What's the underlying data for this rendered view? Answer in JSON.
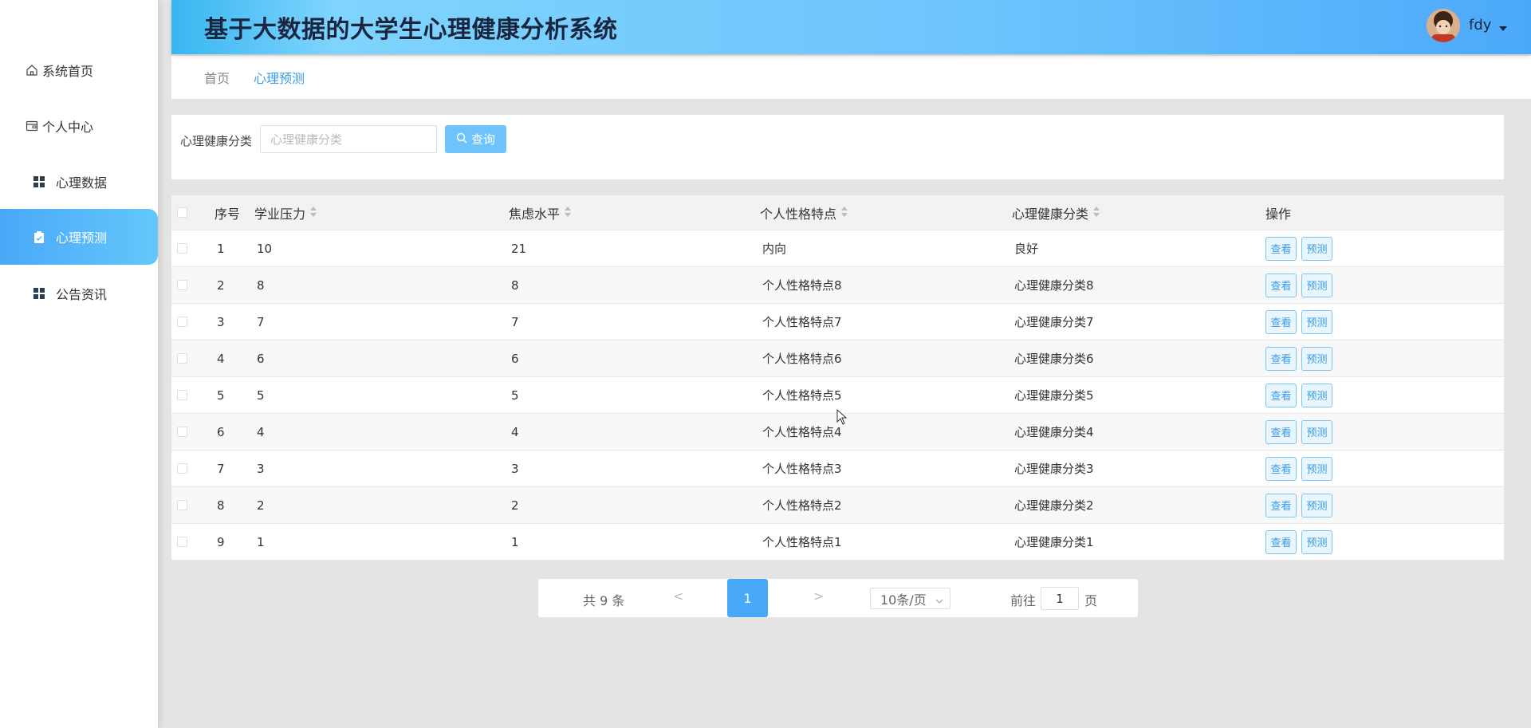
{
  "app": {
    "title": "基于大数据的大学生心理健康分析系统",
    "username": "fdy"
  },
  "sidebar": {
    "items": [
      {
        "label": "系统首页",
        "icon": "home-icon"
      },
      {
        "label": "个人中心",
        "icon": "wallet-icon"
      },
      {
        "label": "心理数据",
        "icon": "grid-icon"
      },
      {
        "label": "心理预测",
        "icon": "clipboard-icon",
        "active": true
      },
      {
        "label": "公告资讯",
        "icon": "grid-icon"
      }
    ]
  },
  "breadcrumb": {
    "home": "首页",
    "current": "心理预测"
  },
  "search": {
    "label": "心理健康分类",
    "placeholder": "心理健康分类",
    "button_label": "查询"
  },
  "table": {
    "headers": {
      "index": "序号",
      "academic_pressure": "学业压力",
      "anxiety_level": "焦虑水平",
      "personality": "个人性格特点",
      "health_category": "心理健康分类",
      "actions": "操作"
    },
    "rows": [
      {
        "index": "1",
        "academic_pressure": "10",
        "anxiety_level": "21",
        "personality": "内向",
        "health_category": "良好"
      },
      {
        "index": "2",
        "academic_pressure": "8",
        "anxiety_level": "8",
        "personality": "个人性格特点8",
        "health_category": "心理健康分类8"
      },
      {
        "index": "3",
        "academic_pressure": "7",
        "anxiety_level": "7",
        "personality": "个人性格特点7",
        "health_category": "心理健康分类7"
      },
      {
        "index": "4",
        "academic_pressure": "6",
        "anxiety_level": "6",
        "personality": "个人性格特点6",
        "health_category": "心理健康分类6"
      },
      {
        "index": "5",
        "academic_pressure": "5",
        "anxiety_level": "5",
        "personality": "个人性格特点5",
        "health_category": "心理健康分类5"
      },
      {
        "index": "6",
        "academic_pressure": "4",
        "anxiety_level": "4",
        "personality": "个人性格特点4",
        "health_category": "心理健康分类4"
      },
      {
        "index": "7",
        "academic_pressure": "3",
        "anxiety_level": "3",
        "personality": "个人性格特点3",
        "health_category": "心理健康分类3"
      },
      {
        "index": "8",
        "academic_pressure": "2",
        "anxiety_level": "2",
        "personality": "个人性格特点2",
        "health_category": "心理健康分类2"
      },
      {
        "index": "9",
        "academic_pressure": "1",
        "anxiety_level": "1",
        "personality": "个人性格特点1",
        "health_category": "心理健康分类1"
      }
    ],
    "view_label": "查看",
    "predict_label": "预测"
  },
  "pagination": {
    "total": "共 9 条",
    "prev": "<",
    "current_page": "1",
    "next": ">",
    "page_size": "10条/页",
    "goto_label": "前往",
    "goto_value": "1",
    "page_unit": "页"
  },
  "colors": {
    "accent": "#4aa8f8",
    "header_gradient_start": "#38b6f1",
    "header_gradient_end": "#4ca9fa"
  }
}
